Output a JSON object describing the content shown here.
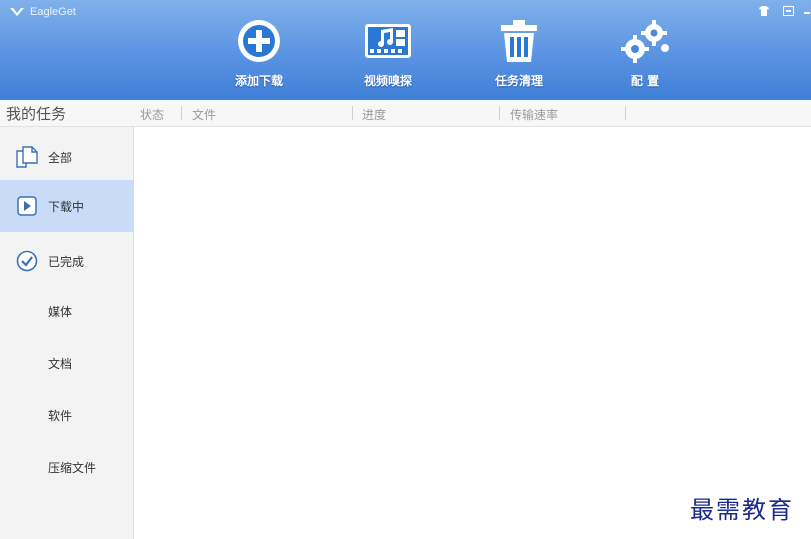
{
  "app": {
    "title": "EagleGet"
  },
  "toolbar": {
    "add_download": "添加下载",
    "video_sniff": "视频嗅探",
    "task_cleanup": "任务清理",
    "settings": "配 置"
  },
  "header": {
    "my_tasks": "我的任务",
    "columns": [
      "状态",
      "文件",
      "进度",
      "传输速率"
    ]
  },
  "sidebar": {
    "items": [
      {
        "label": "全部",
        "icon": "documents-icon"
      },
      {
        "label": "下载中",
        "icon": "play-icon"
      },
      {
        "label": "已完成",
        "icon": "check-circle-icon"
      }
    ],
    "subitems": [
      "媒体",
      "文档",
      "软件",
      "压缩文件"
    ]
  },
  "watermark": "最需教育",
  "colors": {
    "toolbar": "#5a93e2",
    "active": "#c9dcf7",
    "accent": "#1f6fd1"
  }
}
